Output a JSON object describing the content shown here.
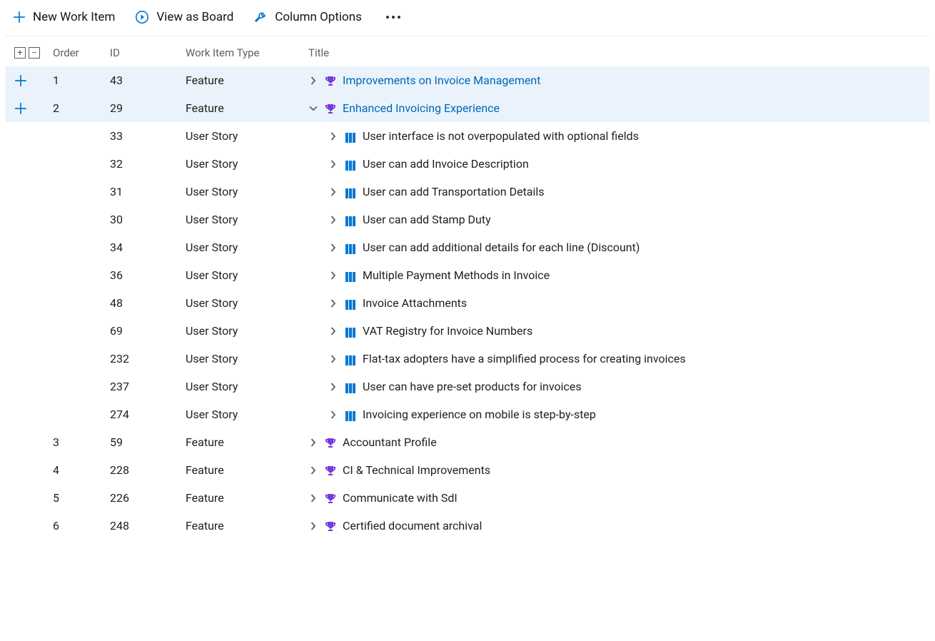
{
  "toolbar": {
    "newItem": "New Work Item",
    "viewBoard": "View as Board",
    "columnOptions": "Column Options"
  },
  "columns": {
    "order": "Order",
    "id": "ID",
    "type": "Work Item Type",
    "title": "Title"
  },
  "rows": [
    {
      "highlight": true,
      "add": true,
      "order": "1",
      "id": "43",
      "type": "Feature",
      "chev": "right",
      "icon": "trophy",
      "indent": 0,
      "link": true,
      "title": "Improvements on Invoice Management"
    },
    {
      "highlight": true,
      "add": true,
      "order": "2",
      "id": "29",
      "type": "Feature",
      "chev": "down",
      "icon": "trophy",
      "indent": 0,
      "link": true,
      "title": "Enhanced Invoicing Experience"
    },
    {
      "highlight": false,
      "add": false,
      "order": "",
      "id": "33",
      "type": "User Story",
      "chev": "right",
      "icon": "book",
      "indent": 1,
      "link": false,
      "title": "User interface is not overpopulated with optional fields"
    },
    {
      "highlight": false,
      "add": false,
      "order": "",
      "id": "32",
      "type": "User Story",
      "chev": "right",
      "icon": "book",
      "indent": 1,
      "link": false,
      "title": "User can add Invoice Description"
    },
    {
      "highlight": false,
      "add": false,
      "order": "",
      "id": "31",
      "type": "User Story",
      "chev": "right",
      "icon": "book",
      "indent": 1,
      "link": false,
      "title": "User can add Transportation Details"
    },
    {
      "highlight": false,
      "add": false,
      "order": "",
      "id": "30",
      "type": "User Story",
      "chev": "right",
      "icon": "book",
      "indent": 1,
      "link": false,
      "title": "User can add Stamp Duty"
    },
    {
      "highlight": false,
      "add": false,
      "order": "",
      "id": "34",
      "type": "User Story",
      "chev": "right",
      "icon": "book",
      "indent": 1,
      "link": false,
      "title": "User can add additional details for each line (Discount)"
    },
    {
      "highlight": false,
      "add": false,
      "order": "",
      "id": "36",
      "type": "User Story",
      "chev": "right",
      "icon": "book",
      "indent": 1,
      "link": false,
      "title": "Multiple Payment Methods in Invoice"
    },
    {
      "highlight": false,
      "add": false,
      "order": "",
      "id": "48",
      "type": "User Story",
      "chev": "right",
      "icon": "book",
      "indent": 1,
      "link": false,
      "title": "Invoice Attachments"
    },
    {
      "highlight": false,
      "add": false,
      "order": "",
      "id": "69",
      "type": "User Story",
      "chev": "right",
      "icon": "book",
      "indent": 1,
      "link": false,
      "title": "VAT Registry for Invoice Numbers"
    },
    {
      "highlight": false,
      "add": false,
      "order": "",
      "id": "232",
      "type": "User Story",
      "chev": "right",
      "icon": "book",
      "indent": 1,
      "link": false,
      "title": "Flat-tax adopters have a simplified process for creating invoices"
    },
    {
      "highlight": false,
      "add": false,
      "order": "",
      "id": "237",
      "type": "User Story",
      "chev": "right",
      "icon": "book",
      "indent": 1,
      "link": false,
      "title": "User can have pre-set products for invoices"
    },
    {
      "highlight": false,
      "add": false,
      "order": "",
      "id": "274",
      "type": "User Story",
      "chev": "right",
      "icon": "book",
      "indent": 1,
      "link": false,
      "title": "Invoicing experience on mobile is step-by-step"
    },
    {
      "highlight": false,
      "add": false,
      "order": "3",
      "id": "59",
      "type": "Feature",
      "chev": "right",
      "icon": "trophy",
      "indent": 0,
      "link": false,
      "title": "Accountant Profile"
    },
    {
      "highlight": false,
      "add": false,
      "order": "4",
      "id": "228",
      "type": "Feature",
      "chev": "right",
      "icon": "trophy",
      "indent": 0,
      "link": false,
      "title": "CI & Technical Improvements"
    },
    {
      "highlight": false,
      "add": false,
      "order": "5",
      "id": "226",
      "type": "Feature",
      "chev": "right",
      "icon": "trophy",
      "indent": 0,
      "link": false,
      "title": "Communicate with SdI"
    },
    {
      "highlight": false,
      "add": false,
      "order": "6",
      "id": "248",
      "type": "Feature",
      "chev": "right",
      "icon": "trophy",
      "indent": 0,
      "link": false,
      "title": "Certified document archival"
    }
  ]
}
